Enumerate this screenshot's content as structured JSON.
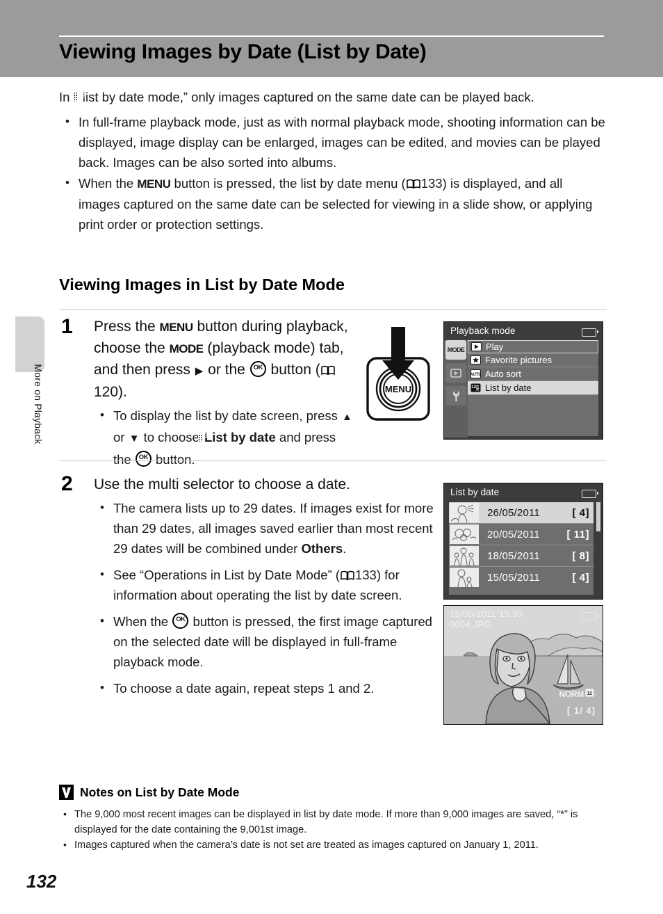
{
  "page": {
    "title": "Viewing Images by Date (List by Date)",
    "number": "132",
    "side_tab_label": "More on Playback"
  },
  "intro": {
    "lead_pre": "In “",
    "lead_post": " list by date mode,” only images captured on the same date can be played back.",
    "bullets": [
      "In full-frame playback mode, just as with normal playback mode, shooting information can be displayed, image display can be enlarged, images can be edited, and movies can be played back. Images can be also sorted into albums.",
      "When the MENU button is pressed, the list by date menu (133) is displayed, and all images captured on the same date can be selected for viewing in a slide show, or applying print order or protection settings."
    ],
    "bullet2_parts": {
      "a": "When the ",
      "menu": "MENU",
      "b": " button is pressed, the list by date menu (",
      "page_ref": "133",
      "c": ") is displayed, and all images captured on the same date can be selected for viewing in a slide show, or applying print order or protection settings."
    }
  },
  "section": {
    "heading": "Viewing Images in List by Date Mode"
  },
  "steps": [
    {
      "number": "1",
      "title_parts": {
        "a": "Press the ",
        "menu": "MENU",
        "b": " button during playback, choose the ",
        "mode": "MODE",
        "c": " (playback mode) tab, and then press ",
        "right_arrow": "▶",
        "d": " or the ",
        "ok": "OK",
        "e": " button (",
        "page_ref": "120",
        "f": ")."
      },
      "sub_parts": {
        "a": "To display the list by date screen, press ",
        "up": "▲",
        "b": " or ",
        "down": "▼",
        "c": " to choose ",
        "bold": "List by date",
        "d": " and press the ",
        "ok": "OK",
        "e": " button."
      }
    },
    {
      "number": "2",
      "title": "Use the multi selector to choose a date.",
      "bullets": [
        {
          "a": "The camera lists up to 29 dates. If images exist for more than 29 dates, all images saved earlier than most recent 29 dates will be combined under ",
          "bold": "Others",
          "b": "."
        },
        {
          "a": "See “Operations in List by Date Mode” (",
          "page_ref": "133",
          "b": ") for information about operating the list by date screen."
        },
        {
          "a": "When the ",
          "ok": "OK",
          "b": " button is pressed, the first image captured on the selected date will be displayed in full-frame playback mode."
        },
        {
          "a": "To choose a date again, repeat steps 1 and 2."
        }
      ]
    }
  ],
  "illustration": {
    "menu_button_label": "MENU"
  },
  "lcd_playback_mode": {
    "title": "Playback mode",
    "tabs": [
      {
        "name": "mode-tab",
        "label": "MODE",
        "selected": true
      },
      {
        "name": "play-tab",
        "label": "",
        "selected": false
      },
      {
        "name": "setup-tab",
        "label": "",
        "selected": false
      }
    ],
    "items": [
      {
        "label": "Play",
        "icon": "play-icon",
        "state": "header"
      },
      {
        "label": "Favorite pictures",
        "icon": "star-icon",
        "state": "normal"
      },
      {
        "label": "Auto sort",
        "icon": "auto-icon",
        "state": "normal"
      },
      {
        "label": "List by date",
        "icon": "calendar-12-icon",
        "state": "selected"
      }
    ]
  },
  "lcd_list_by_date": {
    "title": "List by date",
    "rows": [
      {
        "date": "26/05/2011",
        "count": "[    4]",
        "selected": true
      },
      {
        "date": "20/05/2011",
        "count": "[  11]",
        "selected": false
      },
      {
        "date": "18/05/2011",
        "count": "[    8]",
        "selected": false
      },
      {
        "date": "15/05/2011",
        "count": "[    4]",
        "selected": false
      }
    ]
  },
  "lcd_full_frame": {
    "date": "15/05/2011  15:30",
    "filename": "0004.JPG",
    "quality": "NORM",
    "counter": "[   1/    4]"
  },
  "notes": {
    "heading": "Notes on List by Date Mode",
    "items": [
      "The 9,000 most recent images can be displayed in list by date mode. If more than 9,000 images are saved, “*” is displayed for the date containing the 9,001st image.",
      "Images captured when the camera’s date is not set are treated as images captured on January 1, 2011."
    ]
  },
  "colors": {
    "header_band": "#9b9b9b",
    "lcd_bg": "#3c3c3c",
    "lcd_list_bg": "#6e6e6e",
    "lcd_selected": "#d6d6d6",
    "side_tab": "#d2d2d2"
  }
}
